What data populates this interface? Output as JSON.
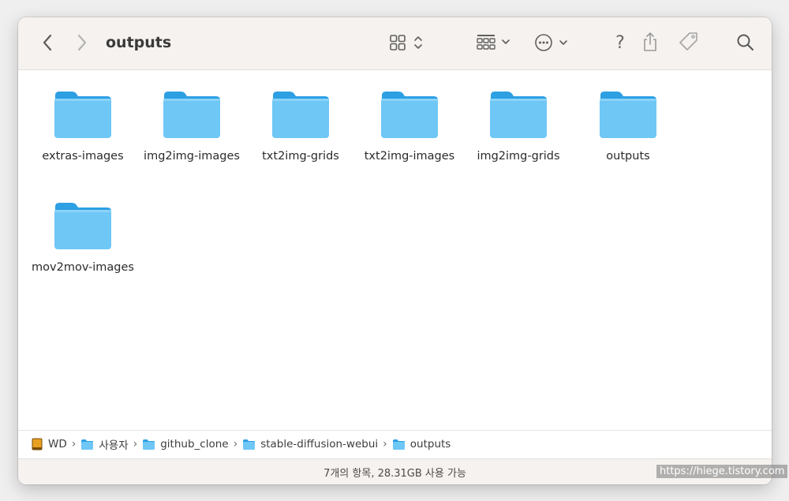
{
  "window": {
    "title": "outputs"
  },
  "toolbar": {
    "back_icon": "chevron-left-icon",
    "forward_icon": "chevron-right-icon",
    "view_icon": "grid-view-icon",
    "group_icon": "group-icon",
    "action_icon": "ellipsis-circle-icon",
    "help_label": "?",
    "share_icon": "share-icon",
    "tag_icon": "tag-icon",
    "search_icon": "search-icon"
  },
  "folders": [
    {
      "name": "extras-images"
    },
    {
      "name": "img2img-images"
    },
    {
      "name": "txt2img-grids"
    },
    {
      "name": "txt2img-images"
    },
    {
      "name": "img2img-grids"
    },
    {
      "name": "outputs"
    },
    {
      "name": "mov2mov-images"
    }
  ],
  "pathbar": {
    "crumbs": [
      {
        "label": "WD",
        "icon": "drive-icon"
      },
      {
        "label": "사용자",
        "icon": "folder-icon"
      },
      {
        "label": "github_clone",
        "icon": "folder-icon"
      },
      {
        "label": "stable-diffusion-webui",
        "icon": "folder-icon"
      },
      {
        "label": "outputs",
        "icon": "folder-icon"
      }
    ],
    "separator": "›"
  },
  "status": {
    "text": "7개의 항목, 28.31GB 사용 가능"
  },
  "watermark": {
    "text": "https://hiege.tistory.com"
  },
  "colors": {
    "folder_front": "#6fc7f6",
    "folder_back": "#2d9fe3",
    "toolbar_bg": "#f6f2ef",
    "icon_gray": "#6e6e6e"
  }
}
